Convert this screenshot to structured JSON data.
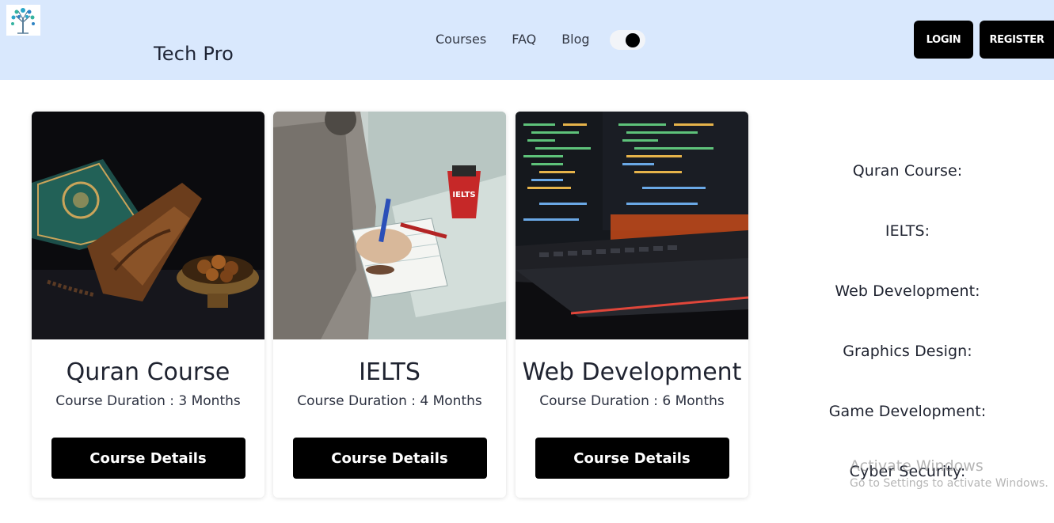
{
  "brand": {
    "name": "Tech Pro",
    "logo_icon": "tree-circuit-logo-icon"
  },
  "nav": {
    "items": [
      "Courses",
      "FAQ",
      "Blog"
    ]
  },
  "header_buttons": {
    "login": "LOGIN",
    "register": "REGISTER"
  },
  "theme_toggle": {
    "state": "on"
  },
  "cards": [
    {
      "title": "Quran Course",
      "duration": "Course Duration : 3 Months",
      "button": "Course Details",
      "image": "quran-book-and-dates-image"
    },
    {
      "title": "IELTS",
      "duration": "Course Duration : 4 Months",
      "button": "Course Details",
      "image": "student-writing-with-ielts-cup-image"
    },
    {
      "title": "Web Development",
      "duration": "Course Duration : 6 Months",
      "button": "Course Details",
      "image": "code-monitor-and-keyboard-image"
    }
  ],
  "sidebar": {
    "items": [
      "Quran Course:",
      "IELTS:",
      "Web Development:",
      "Graphics Design:",
      "Game Development:",
      "Cyber Security:"
    ]
  },
  "watermark": {
    "line1": "Activate Windows",
    "line2": "Go to Settings to activate Windows."
  },
  "colors": {
    "header_bg": "#d9e8fd",
    "button_bg": "#000000",
    "text": "#1f2330"
  }
}
